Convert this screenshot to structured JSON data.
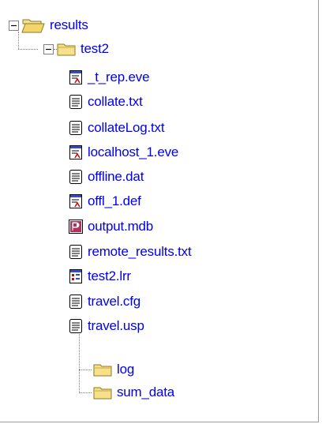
{
  "tree": {
    "root": {
      "label": "results",
      "icon": "open-folder-icon",
      "expanded": true
    },
    "folder": {
      "label": "test2",
      "icon": "closed-folder-icon",
      "expanded": true
    },
    "files": [
      {
        "label": "_t_rep.eve",
        "icon": "eve-file-icon"
      },
      {
        "label": "collate.txt",
        "icon": "text-file-icon"
      },
      {
        "label": "collateLog.txt",
        "icon": "text-file-icon"
      },
      {
        "label": "localhost_1.eve",
        "icon": "eve-file-icon"
      },
      {
        "label": "offline.dat",
        "icon": "text-file-icon"
      },
      {
        "label": "offl_1.def",
        "icon": "eve-file-icon"
      },
      {
        "label": "output.mdb",
        "icon": "access-db-icon"
      },
      {
        "label": "remote_results.txt",
        "icon": "text-file-icon"
      },
      {
        "label": "test2.lrr",
        "icon": "lrr-file-icon"
      },
      {
        "label": "travel.cfg",
        "icon": "text-file-icon"
      },
      {
        "label": "travel.usp",
        "icon": "text-file-icon"
      }
    ],
    "subfolders": [
      {
        "label": "log",
        "icon": "closed-folder-icon"
      },
      {
        "label": "sum_data",
        "icon": "closed-folder-icon"
      }
    ]
  },
  "colors": {
    "label": "#0000ee",
    "folder_fill": "#f6e08a",
    "folder_edge": "#8a7a2a",
    "tree_line": "#808080"
  }
}
